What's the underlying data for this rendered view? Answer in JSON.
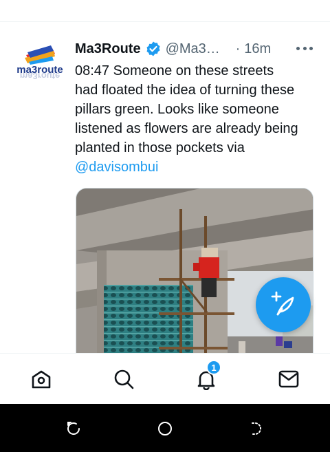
{
  "tweet": {
    "display_name": "Ma3Route",
    "handle": "@Ma3Route",
    "separator": "·",
    "time": "16m",
    "text_lines": [
      "08:47 Someone on these streets",
      "had floated the idea of turning these",
      "pillars green. Looks like someone",
      "listened as flowers are already being",
      "planted in those pockets   via"
    ],
    "mention": "@davisombui",
    "avatar_text": "ma3route"
  },
  "bottom_nav": {
    "items": [
      "home-icon",
      "search-icon",
      "bell-icon",
      "mail-icon"
    ],
    "notification_count": "1"
  },
  "system_nav": [
    "recent-apps-icon",
    "home-circle-icon",
    "back-icon"
  ],
  "colors": {
    "accent": "#1d9bf0",
    "text": "#0f1419",
    "muted": "#536471"
  }
}
